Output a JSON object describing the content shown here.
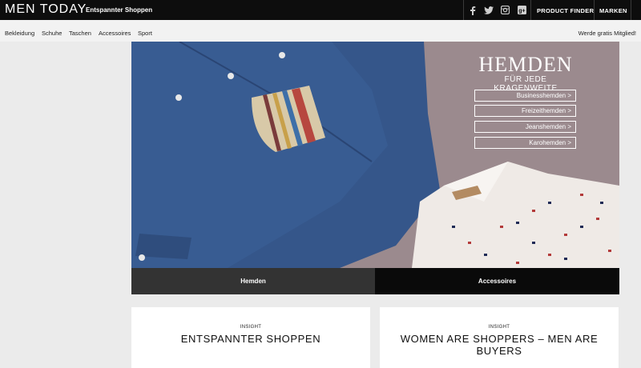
{
  "header": {
    "logo": "MEN TODAY",
    "tagline": "Entspannter Shoppen",
    "social_icons": [
      "facebook-icon",
      "twitter-icon",
      "instagram-icon",
      "google-plus-icon"
    ],
    "links": [
      "PRODUCT FINDER",
      "MARKEN"
    ]
  },
  "nav": {
    "items": [
      "Bekleidung",
      "Schuhe",
      "Taschen",
      "Accessoires",
      "Sport"
    ],
    "member_link": "Werde gratis Mitglied!"
  },
  "hero": {
    "title": "HEMDEN",
    "subtitle": "FÜR JEDE KRAGENWEITE",
    "links": [
      "Businesshemden >",
      "Freizeithemden >",
      "Jeanshemden >",
      "Karohemden >"
    ],
    "colors": {
      "denim": "#3a5a8c",
      "background": "#9c8b8f"
    }
  },
  "tabs": [
    "Hemden",
    "Accessoires"
  ],
  "cards": [
    {
      "kicker": "INSIGHT",
      "title": "ENTSPANNTER SHOPPEN"
    },
    {
      "kicker": "INSIGHT",
      "title": "WOMEN ARE SHOPPERS – MEN ARE BUYERS"
    }
  ]
}
